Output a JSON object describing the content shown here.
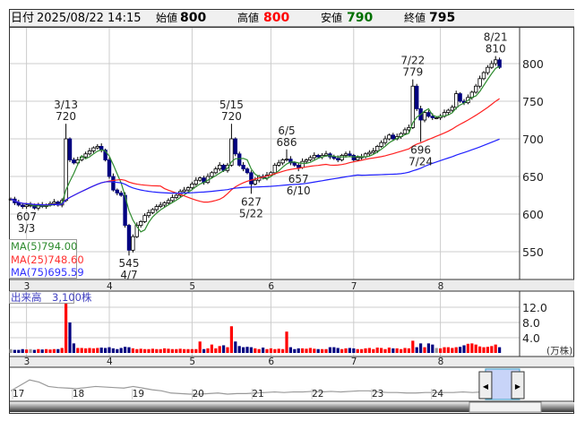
{
  "header": {
    "date_label": "日付",
    "date": "2025/08/22 14:15",
    "open_label": "始値",
    "open": "800",
    "high_label": "高値",
    "high": "800",
    "low_label": "安値",
    "low": "790",
    "close_label": "終値",
    "close": "795"
  },
  "colors": {
    "up_body": "#ffffff",
    "down_body": "#000080",
    "ma5": "#2e8b2e",
    "ma25": "#ff2020",
    "ma75": "#2020ff",
    "vol_up": "#ff0000",
    "vol_down": "#000080",
    "vol_flat": "#999999",
    "high_text": "#ff0000",
    "low_text": "#007000"
  },
  "ma_legend": [
    {
      "label": "MA(5)",
      "value": "794.00"
    },
    {
      "label": "MA(25)",
      "value": "748.60"
    },
    {
      "label": "MA(75)",
      "value": "695.59"
    }
  ],
  "volume_label": "出来高　3,100株",
  "volume_unit": "(万株)",
  "chart_data": {
    "type": "candlestick",
    "price_axis": {
      "ticks": [
        800,
        750,
        700,
        650,
        600,
        550
      ],
      "range": [
        520,
        845
      ]
    },
    "volume_axis": {
      "ticks": [
        "12.0",
        "8.0",
        "4.0"
      ],
      "tick_values": [
        12,
        8,
        4
      ],
      "unit": "万株"
    },
    "month_labels": [
      {
        "label": "3",
        "index": 4
      },
      {
        "label": "4",
        "index": 25
      },
      {
        "label": "5",
        "index": 46
      },
      {
        "label": "6",
        "index": 66
      },
      {
        "label": "7",
        "index": 87
      },
      {
        "label": "8",
        "index": 109
      }
    ],
    "closes": [
      620,
      615,
      612,
      610,
      612,
      612,
      608,
      612,
      610,
      612,
      614,
      616,
      612,
      618,
      700,
      672,
      668,
      672,
      676,
      680,
      684,
      688,
      690,
      685,
      672,
      650,
      632,
      628,
      625,
      585,
      552,
      570,
      585,
      590,
      598,
      602,
      606,
      610,
      612,
      615,
      618,
      622,
      625,
      630,
      632,
      635,
      640,
      645,
      648,
      642,
      650,
      655,
      660,
      665,
      658,
      665,
      700,
      680,
      665,
      660,
      655,
      640,
      645,
      650,
      648,
      652,
      655,
      665,
      668,
      672,
      673,
      668,
      665,
      662,
      670,
      672,
      675,
      678,
      676,
      678,
      680,
      676,
      674,
      672,
      678,
      680,
      678,
      672,
      675,
      676,
      680,
      682,
      684,
      690,
      695,
      700,
      705,
      700,
      703,
      707,
      712,
      715,
      770,
      740,
      725,
      735,
      730,
      728,
      728,
      730,
      735,
      738,
      742,
      760,
      750,
      748,
      755,
      762,
      770,
      780,
      788,
      795,
      800,
      805,
      795
    ],
    "volumes": [
      1.0,
      0.8,
      0.8,
      1.0,
      0.9,
      1.0,
      0.8,
      1.0,
      0.9,
      1.0,
      0.9,
      1.0,
      1.0,
      1.3,
      13.0,
      8.0,
      2.5,
      1.3,
      1.3,
      1.2,
      1.3,
      1.2,
      1.3,
      1.4,
      1.3,
      1.5,
      1.2,
      1.0,
      1.3,
      1.6,
      1.5,
      1.2,
      1.0,
      1.1,
      1.0,
      1.0,
      1.1,
      1.0,
      1.0,
      1.2,
      1.1,
      1.0,
      1.0,
      1.1,
      1.0,
      1.0,
      1.0,
      1.0,
      3.0,
      1.0,
      1.2,
      2.2,
      1.2,
      1.8,
      2.0,
      1.5,
      7.0,
      3.0,
      1.8,
      1.5,
      1.6,
      1.5,
      1.2,
      1.0,
      1.4,
      1.0,
      1.2,
      1.0,
      1.1,
      1.0,
      5.6,
      1.5,
      1.0,
      1.2,
      1.2,
      1.1,
      1.3,
      1.1,
      1.0,
      1.0,
      1.0,
      1.5,
      1.5,
      1.3,
      1.0,
      1.2,
      1.3,
      1.2,
      1.0,
      1.0,
      1.2,
      1.3,
      1.0,
      1.4,
      1.3,
      1.0,
      1.4,
      1.2,
      1.2,
      1.0,
      1.3,
      1.2,
      3.2,
      1.5,
      2.5,
      1.5,
      2.5,
      2.2,
      1.3,
      1.2,
      1.5,
      1.5,
      1.3,
      1.5,
      1.6,
      2.0,
      2.4,
      2.5,
      2.2,
      1.7,
      1.5,
      1.6,
      1.8,
      2.2,
      1.5
    ],
    "annotations": [
      {
        "index": 4,
        "kind": "low",
        "value": 607,
        "date": "3/3",
        "value_label": "607"
      },
      {
        "index": 14,
        "kind": "high",
        "value": 720,
        "date": "3/13",
        "value_label": "720"
      },
      {
        "index": 30,
        "kind": "low",
        "value": 545,
        "date": "4/7",
        "value_label": "545"
      },
      {
        "index": 56,
        "kind": "high",
        "value": 720,
        "date": "5/15",
        "value_label": "720"
      },
      {
        "index": 61,
        "kind": "low",
        "value": 627,
        "date": "5/22",
        "value_label": "627"
      },
      {
        "index": 70,
        "kind": "high",
        "value": 686,
        "date": "6/5",
        "value_label": "686"
      },
      {
        "index": 73,
        "kind": "low",
        "value": 657,
        "date": "6/10",
        "value_label": "657"
      },
      {
        "index": 102,
        "kind": "high",
        "value": 779,
        "date": "7/22",
        "value_label": "779"
      },
      {
        "index": 104,
        "kind": "low",
        "value": 696,
        "date": "7/24",
        "value_label": "696"
      },
      {
        "index": 123,
        "kind": "high",
        "value": 810,
        "date": "8/21",
        "value_label": "810"
      }
    ]
  },
  "navigator": {
    "year_labels": [
      "17",
      "18",
      "19",
      "20",
      "21",
      "22",
      "23",
      "24"
    ],
    "values": [
      30,
      20,
      10,
      14,
      22,
      24,
      25,
      26,
      24,
      22,
      23,
      24,
      25,
      22,
      25,
      28,
      30,
      34,
      35,
      36,
      36,
      35,
      34,
      36,
      35,
      35,
      34,
      33,
      32,
      33,
      32,
      32,
      31,
      32,
      31,
      32,
      31,
      30,
      30,
      32,
      33,
      33,
      34,
      34,
      33,
      33,
      33,
      33,
      32,
      33,
      32,
      33,
      30,
      30,
      31
    ],
    "selection_fraction": [
      0.94,
      1.0
    ]
  }
}
